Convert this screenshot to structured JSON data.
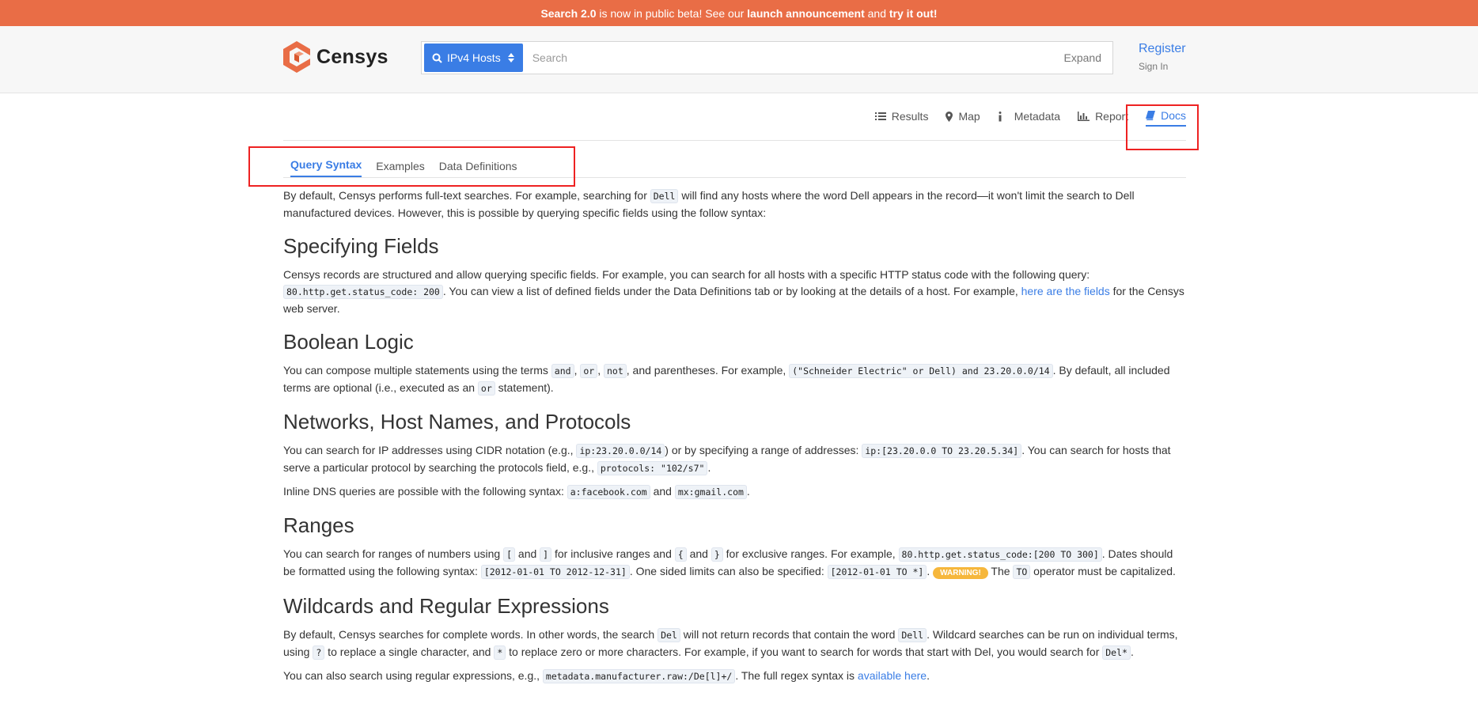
{
  "banner": {
    "b1": "Search 2.0",
    "t1": " is now in public beta! See our ",
    "b2": "launch announcement",
    "t2": " and ",
    "b3": "try it out!"
  },
  "header": {
    "logo_text": "Censys",
    "search_type": "IPv4 Hosts",
    "search_placeholder": "Search",
    "expand": "Expand",
    "register": "Register",
    "sign_in": "Sign In"
  },
  "view_tabs": [
    "Results",
    "Map",
    "Metadata",
    "Report",
    "Docs"
  ],
  "doc_tabs": [
    "Query Syntax",
    "Examples",
    "Data Definitions"
  ],
  "doc": {
    "intro": [
      "By default, Censys performs full-text searches. For example, searching for ",
      "Dell",
      " will find any hosts where the word Dell appears in the record—it won't limit the search to Dell manufactured devices. However, this is possible by querying specific fields using the follow syntax:"
    ],
    "h_fields": "Specifying Fields",
    "fields": [
      "Censys records are structured and allow querying specific fields. For example, you can search for all hosts with a specific HTTP status code with the following query: ",
      "80.http.get.status_code: 200",
      ". You can view a list of defined fields under the Data Definitions tab or by looking at the details of a host. For example, ",
      "here are the fields",
      " for the Censys web server."
    ],
    "h_bool": "Boolean Logic",
    "bool": [
      "You can compose multiple statements using the terms ",
      "and",
      ", ",
      "or",
      ", ",
      "not",
      ", and parentheses. For example, ",
      "(\"Schneider Electric\" or Dell) and 23.20.0.0/14",
      ". By default, all included terms are optional (i.e., executed as an ",
      "or",
      " statement)."
    ],
    "h_net": "Networks, Host Names, and Protocols",
    "net": [
      "You can search for IP addresses using CIDR notation (e.g., ",
      "ip:23.20.0.0/14",
      ") or by specifying a range of addresses: ",
      "ip:[23.20.0.0 TO 23.20.5.34]",
      ". You can search for hosts that serve a particular protocol by searching the protocols field, e.g., ",
      "protocols: \"102/s7\"",
      "."
    ],
    "dns": [
      "Inline DNS queries are possible with the following syntax: ",
      "a:facebook.com",
      " and ",
      "mx:gmail.com",
      "."
    ],
    "h_ranges": "Ranges",
    "ranges": [
      "You can search for ranges of numbers using ",
      "[",
      " and ",
      "]",
      " for inclusive ranges and ",
      "{",
      " and ",
      "}",
      " for exclusive ranges. For example, ",
      "80.http.get.status_code:[200 TO 300]",
      ". Dates should be formatted using the following syntax: ",
      "[2012-01-01 TO 2012-12-31]",
      ". One sided limits can also be specified: ",
      "[2012-01-01 TO *]",
      ". ",
      "WARNING!",
      " The ",
      "TO",
      " operator must be capitalized."
    ],
    "h_wild": "Wildcards and Regular Expressions",
    "wild": [
      "By default, Censys searches for complete words. In other words, the search ",
      "Del",
      " will not return records that contain the word ",
      "Dell",
      ". Wildcard searches can be run on individual terms, using ",
      "?",
      " to replace a single character, and ",
      "*",
      " to replace zero or more characters. For example, if you want to search for words that start with Del, you would search for ",
      "Del*",
      "."
    ],
    "regex": [
      "You can also search using regular expressions, e.g., ",
      "metadata.manufacturer.raw:/De[l]+/",
      ". The full regex syntax is ",
      "available here",
      "."
    ]
  },
  "colors": {
    "banner": "#e96d46",
    "accent": "#3a7de5",
    "highlight_box": "#e22222",
    "warning": "#f6b73c"
  }
}
